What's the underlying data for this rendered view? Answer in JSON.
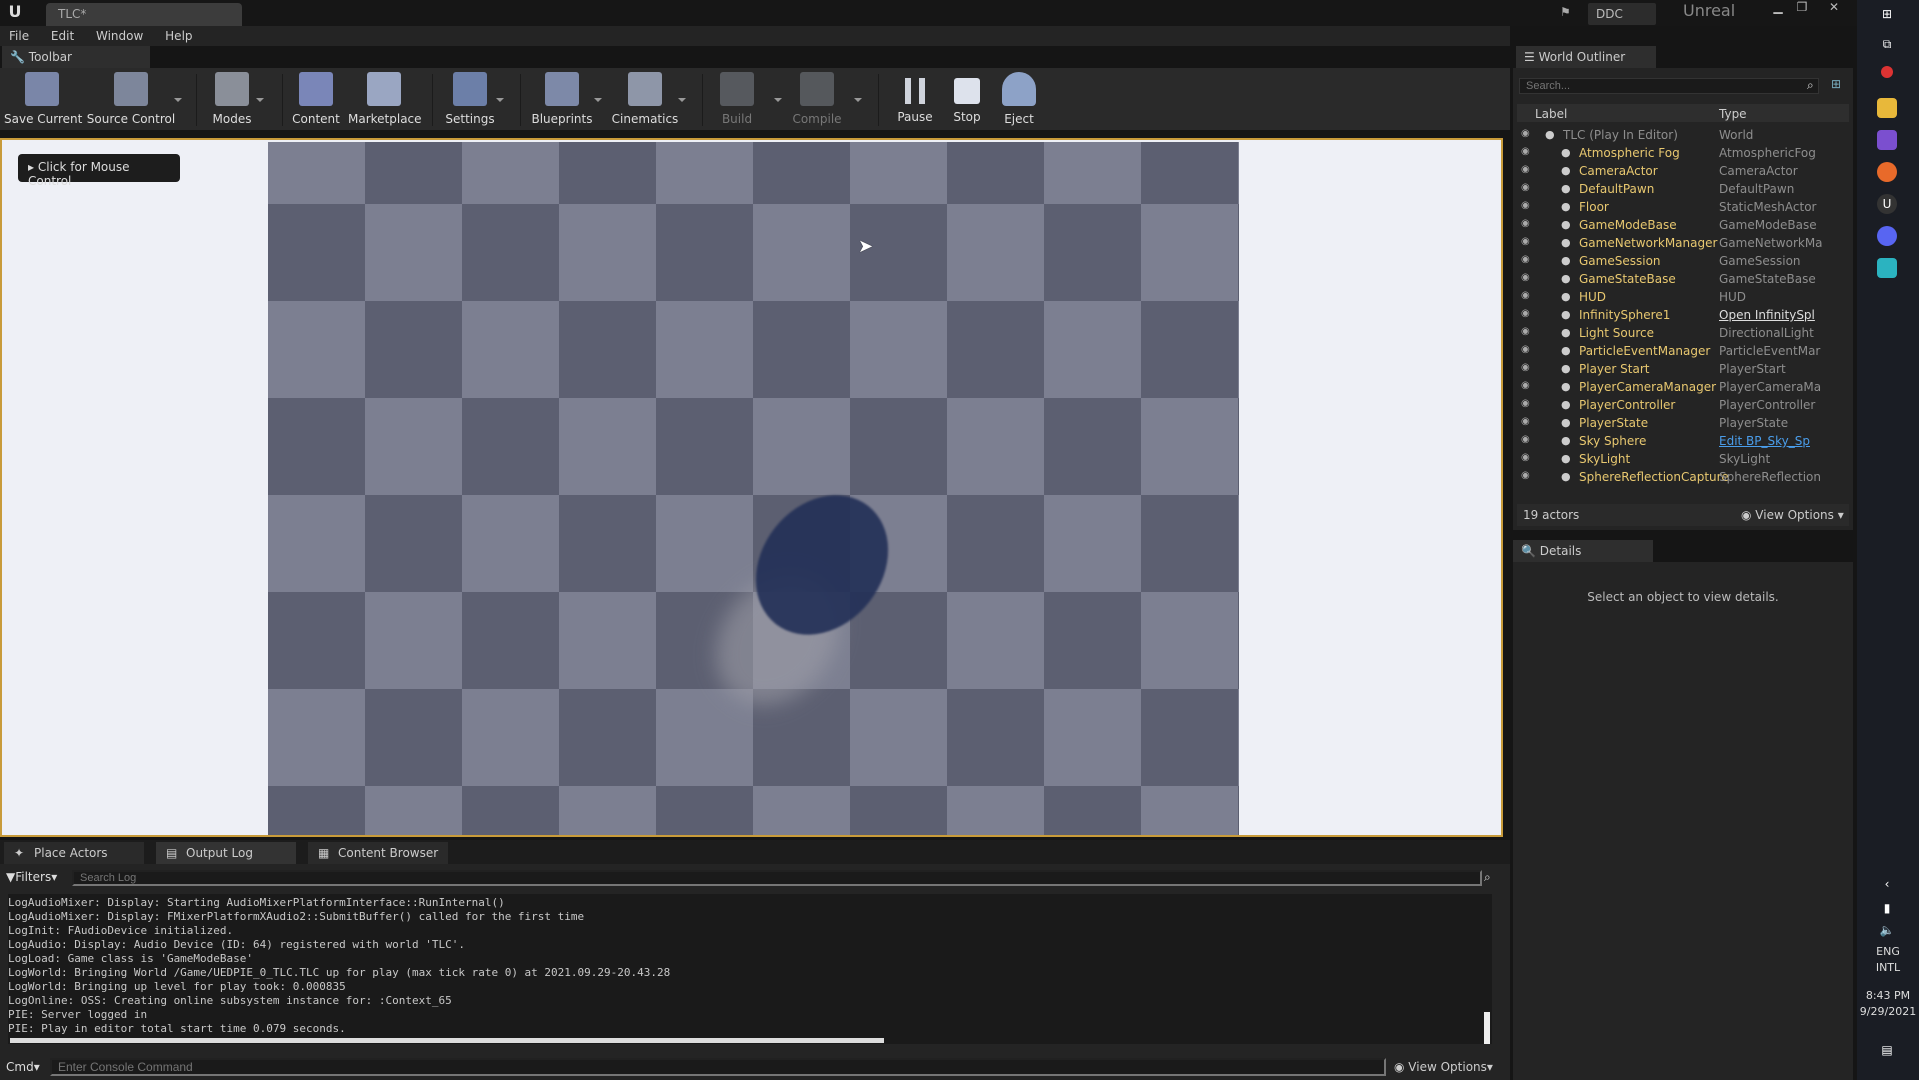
{
  "window": {
    "doc_tab": "TLC*",
    "ddc": "DDC",
    "unreal_label": "Unreal"
  },
  "menu": [
    "File",
    "Edit",
    "Window",
    "Help"
  ],
  "toolbar": {
    "tab_label": "Toolbar",
    "buttons": [
      {
        "label": "Save Current",
        "icon": "save-icon"
      },
      {
        "label": "Source Control",
        "icon": "source-control-icon"
      },
      {
        "label": "Modes",
        "icon": "modes-icon"
      },
      {
        "label": "Content",
        "icon": "content-icon"
      },
      {
        "label": "Marketplace",
        "icon": "marketplace-icon"
      },
      {
        "label": "Settings",
        "icon": "settings-icon"
      },
      {
        "label": "Blueprints",
        "icon": "blueprints-icon"
      },
      {
        "label": "Cinematics",
        "icon": "cinematics-icon"
      },
      {
        "label": "Build",
        "icon": "build-icon"
      },
      {
        "label": "Compile",
        "icon": "compile-icon"
      },
      {
        "label": "Pause",
        "icon": "pause-icon"
      },
      {
        "label": "Stop",
        "icon": "stop-icon"
      },
      {
        "label": "Eject",
        "icon": "eject-icon"
      }
    ]
  },
  "viewport": {
    "mouse_control": "Click for Mouse Control"
  },
  "outliner": {
    "tab_label": "World Outliner",
    "search_placeholder": "Search...",
    "col_label": "Label",
    "col_type": "Type",
    "rows": [
      {
        "label": "TLC (Play In Editor)",
        "type": "World"
      },
      {
        "label": "Atmospheric Fog",
        "type": "AtmosphericFog"
      },
      {
        "label": "CameraActor",
        "type": "CameraActor"
      },
      {
        "label": "DefaultPawn",
        "type": "DefaultPawn"
      },
      {
        "label": "Floor",
        "type": "StaticMeshActor"
      },
      {
        "label": "GameModeBase",
        "type": "GameModeBase"
      },
      {
        "label": "GameNetworkManager",
        "type": "GameNetworkMa"
      },
      {
        "label": "GameSession",
        "type": "GameSession"
      },
      {
        "label": "GameStateBase",
        "type": "GameStateBase"
      },
      {
        "label": "HUD",
        "type": "HUD"
      },
      {
        "label": "InfinitySphere1",
        "type": "Open InfinitySpl"
      },
      {
        "label": "Light Source",
        "type": "DirectionalLight"
      },
      {
        "label": "ParticleEventManager",
        "type": "ParticleEventMar"
      },
      {
        "label": "Player Start",
        "type": "PlayerStart"
      },
      {
        "label": "PlayerCameraManager",
        "type": "PlayerCameraMa"
      },
      {
        "label": "PlayerController",
        "type": "PlayerController"
      },
      {
        "label": "PlayerState",
        "type": "PlayerState"
      },
      {
        "label": "Sky Sphere",
        "type": "Edit BP_Sky_Sp"
      },
      {
        "label": "SkyLight",
        "type": "SkyLight"
      },
      {
        "label": "SphereReflectionCapture",
        "type": "SphereReflection"
      }
    ],
    "actor_count": "19 actors",
    "view_options": "View Options"
  },
  "details": {
    "tab_label": "Details",
    "message": "Select an object to view details."
  },
  "bottom_tabs": [
    "Place Actors",
    "Output Log",
    "Content Browser"
  ],
  "log": {
    "filters": "Filters",
    "search_placeholder": "Search Log",
    "lines": [
      "LogAudioMixer: Display: Starting AudioMixerPlatformInterface::RunInternal()",
      "LogAudioMixer: Display: FMixerPlatformXAudio2::SubmitBuffer() called for the first time",
      "LogInit: FAudioDevice initialized.",
      "LogAudio: Display: Audio Device (ID: 64) registered with world 'TLC'.",
      "LogLoad: Game class is 'GameModeBase'",
      "LogWorld: Bringing World /Game/UEDPIE_0_TLC.TLC up for play (max tick rate 0) at 2021.09.29-20.43.28",
      "LogWorld: Bringing up level for play took: 0.000835",
      "LogOnline: OSS: Creating online subsystem instance for: :Context_65",
      "PIE: Server logged in",
      "PIE: Play in editor total start time 0.079 seconds."
    ],
    "cmd_label": "Cmd",
    "cmd_placeholder": "Enter Console Command",
    "view_options": "View Options"
  },
  "taskbar": {
    "lang": [
      "ENG",
      "INTL"
    ],
    "time": "8:43 PM",
    "date": "9/29/2021"
  }
}
